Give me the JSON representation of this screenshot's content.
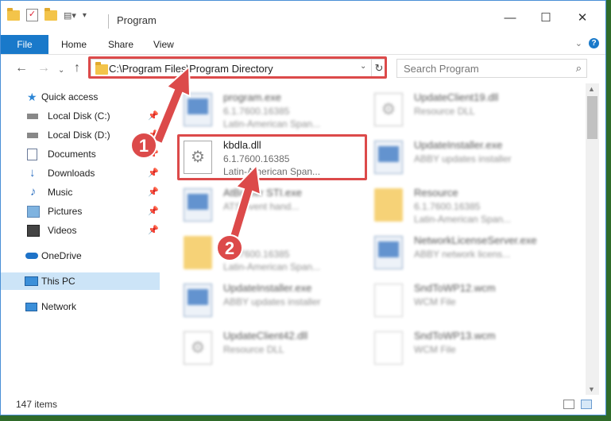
{
  "window": {
    "title": "Program",
    "controls": {
      "minimize": "—",
      "maximize": "☐",
      "close": "✕"
    }
  },
  "ribbon": {
    "tabs": [
      "File",
      "Home",
      "Share",
      "View"
    ]
  },
  "nav": {
    "address": "C:\\Program Files\\Program Directory",
    "search_placeholder": "Search Program"
  },
  "sidebar": {
    "items": [
      {
        "label": "Quick access",
        "icon": "star-icon",
        "pinned": false
      },
      {
        "label": "Local Disk (C:)",
        "icon": "drive-icon",
        "pinned": true
      },
      {
        "label": "Local Disk (D:)",
        "icon": "drive-icon",
        "pinned": true
      },
      {
        "label": "Documents",
        "icon": "documents-icon",
        "pinned": true
      },
      {
        "label": "Downloads",
        "icon": "download-icon",
        "pinned": true
      },
      {
        "label": "Music",
        "icon": "music-icon",
        "pinned": true
      },
      {
        "label": "Pictures",
        "icon": "pictures-icon",
        "pinned": true
      },
      {
        "label": "Videos",
        "icon": "videos-icon",
        "pinned": true
      },
      {
        "label": "OneDrive",
        "icon": "cloud-icon",
        "pinned": false
      },
      {
        "label": "This PC",
        "icon": "computer-icon",
        "pinned": false,
        "selected": true
      },
      {
        "label": "Network",
        "icon": "network-icon",
        "pinned": false
      }
    ]
  },
  "files": {
    "left": [
      {
        "name": "program.exe",
        "line2": "6.1.7600.16385",
        "line3": "Latin-American Span...",
        "icon": "exe-icon"
      },
      {
        "name": "kbdla.dll",
        "line2": "6.1.7600.16385",
        "line3": "Latin-American Span...",
        "icon": "dll-gear-icon",
        "highlighted": true
      },
      {
        "name": "AtBroker STI.exe",
        "line2": "ATS event hand...",
        "line3": "",
        "icon": "exe-icon"
      },
      {
        "name": "",
        "line2": "6.1.7600.16385",
        "line3": "Latin-American Span...",
        "icon": "folder-icon"
      },
      {
        "name": "UpdateInstaller.exe",
        "line2": "ABBY updates installer",
        "line3": "",
        "icon": "exe-icon"
      },
      {
        "name": "UpdateClient42.dll",
        "line2": "Resource DLL",
        "line3": "",
        "icon": "dll-gear-icon"
      }
    ],
    "right": [
      {
        "name": "UpdateClient19.dll",
        "line2": "Resource DLL",
        "line3": "",
        "icon": "dll-gear-icon"
      },
      {
        "name": "UpdateInstaller.exe",
        "line2": "ABBY updates installer",
        "line3": "",
        "icon": "exe-icon"
      },
      {
        "name": "Resource",
        "line2": "6.1.7600.16385",
        "line3": "Latin-American Span...",
        "icon": "folder-icon"
      },
      {
        "name": "NetworkLicenseServer.exe",
        "line2": "ABBY network licens...",
        "line3": "",
        "icon": "exe-icon"
      },
      {
        "name": "SndToWP12.wcm",
        "line2": "WCM File",
        "line3": "",
        "icon": "file-icon"
      },
      {
        "name": "SndToWP13.wcm",
        "line2": "WCM File",
        "line3": "",
        "icon": "file-icon"
      }
    ]
  },
  "status": {
    "items": "147 items"
  },
  "annotations": {
    "badge1": "1",
    "badge2": "2",
    "color": "#dc4a4a"
  }
}
